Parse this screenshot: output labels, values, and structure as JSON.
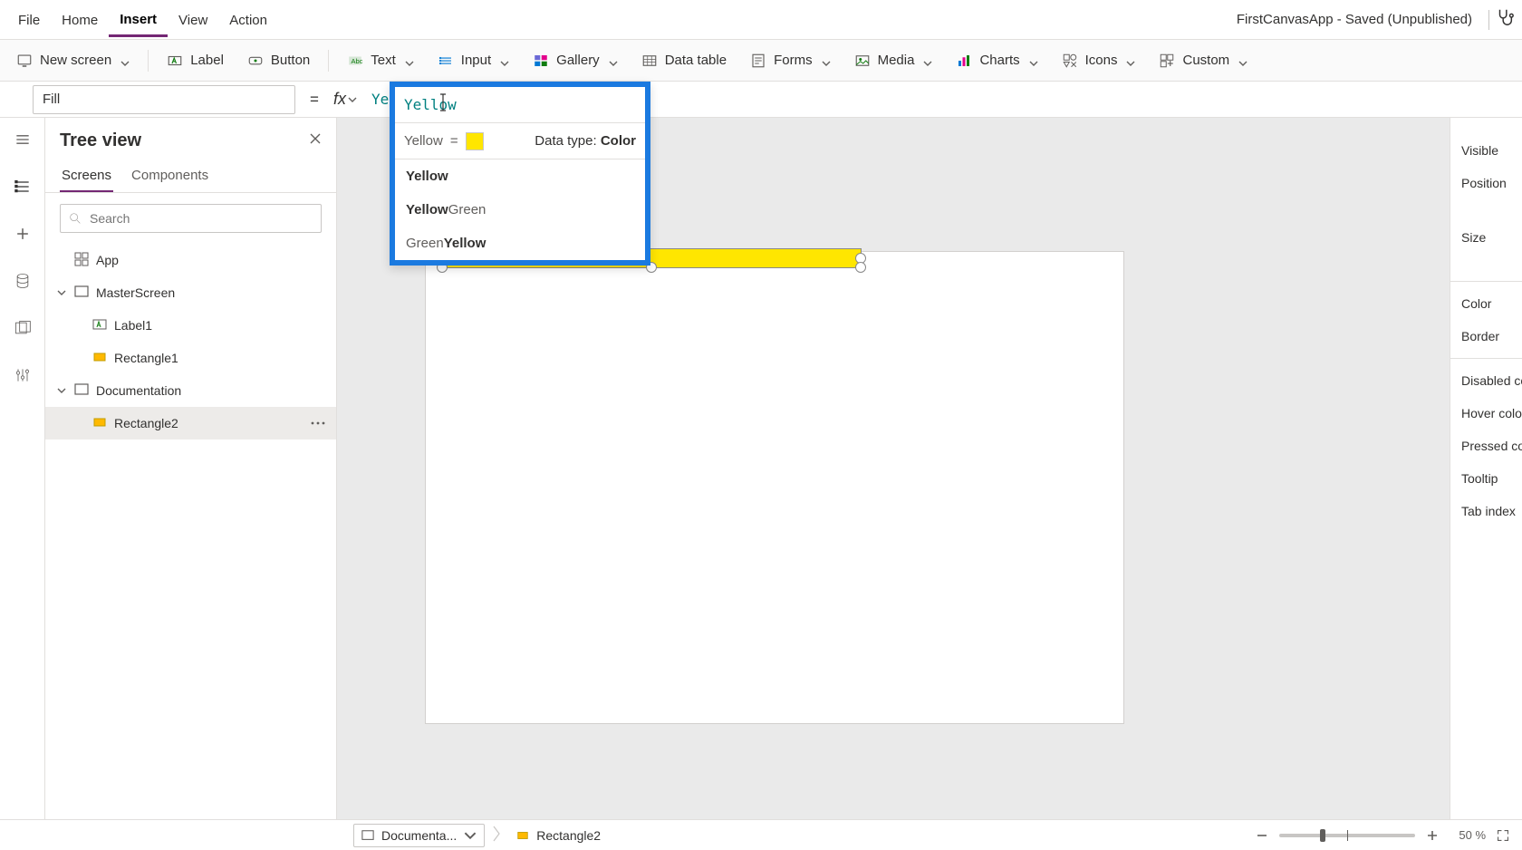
{
  "app_title": "FirstCanvasApp - Saved (Unpublished)",
  "menu": {
    "items": [
      "File",
      "Home",
      "Insert",
      "View",
      "Action"
    ],
    "active": "Insert"
  },
  "ribbon": {
    "new_screen": "New screen",
    "label": "Label",
    "button": "Button",
    "text": "Text",
    "input": "Input",
    "gallery": "Gallery",
    "data_table": "Data table",
    "forms": "Forms",
    "media": "Media",
    "charts": "Charts",
    "icons": "Icons",
    "custom": "Custom"
  },
  "formula": {
    "property": "Fill",
    "eq": "=",
    "fx": "fx",
    "value": "Yellow"
  },
  "autocomplete": {
    "input_value": "Yellow",
    "eval_label": "Yellow",
    "eq": "=",
    "swatch_color": "#ffe600",
    "data_type_label": "Data type:",
    "data_type_value": "Color",
    "suggestions": [
      {
        "pre": "",
        "match": "Yellow",
        "post": ""
      },
      {
        "pre": "",
        "match": "Yellow",
        "post": "Green"
      },
      {
        "pre": "Green",
        "match": "Yellow",
        "post": ""
      }
    ]
  },
  "tree": {
    "title": "Tree view",
    "tabs": {
      "screens": "Screens",
      "components": "Components"
    },
    "search_placeholder": "Search",
    "nodes": {
      "app": "App",
      "screen1": "MasterScreen",
      "screen1_children": [
        "Label1",
        "Rectangle1"
      ],
      "screen2": "Documentation",
      "screen2_children": [
        "Rectangle2"
      ],
      "selected": "Rectangle2"
    }
  },
  "properties": {
    "visible": "Visible",
    "position": "Position",
    "size": "Size",
    "color": "Color",
    "border": "Border",
    "disabled_color": "Disabled color",
    "hover_color": "Hover color",
    "pressed_color": "Pressed color",
    "tooltip": "Tooltip",
    "tab_index": "Tab index"
  },
  "status": {
    "screen_crumb": "Documenta...",
    "selection_crumb": "Rectangle2",
    "zoom_value": "50",
    "zoom_suffix": "%",
    "slider_pos_pct": 30
  }
}
